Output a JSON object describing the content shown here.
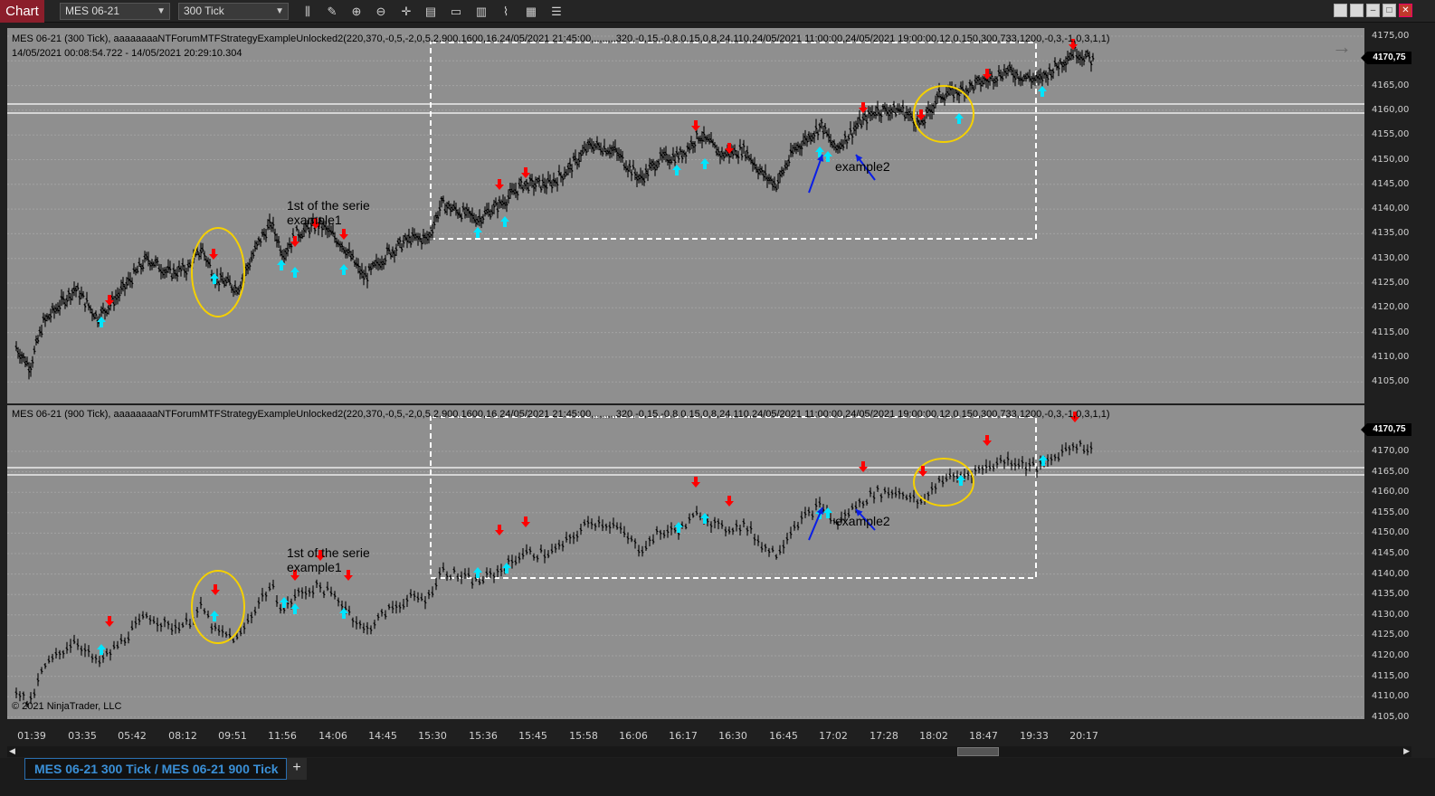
{
  "app": {
    "tab_label": "Chart"
  },
  "toolbar": {
    "instrument": "MES 06-21",
    "interval": "300 Tick",
    "icons": [
      "bar-type-icon",
      "draw-icon",
      "zoom-in-icon",
      "zoom-out-icon",
      "crosshair-icon",
      "data-box-icon",
      "drawing-objects-icon",
      "indicators-icon",
      "strategies-icon",
      "properties-icon",
      "menu-icon"
    ]
  },
  "panel_top": {
    "header": "MES 06-21 (300 Tick), aaaaaaaaNTForumMTFStrategyExampleUnlocked2(220,370,-0,5,-2,0,5,2,900,1600,16,24/05/2021 21:45:00,,,,,,,,,320,-0,15,-0,8,0,15,0,8,24,110,24/05/2021 11:00:00,24/05/2021 19:00:00,12,0,150,300,733,1200,-0,3,-1,0,3,1,1)",
    "date_range": "14/05/2021 00:08:54.722 - 14/05/2021 20:29:10.304",
    "annotation1_line1": "1st of the serie",
    "annotation1_line2": "example1",
    "annotation2": "example2",
    "last_price": "4170,75",
    "price_ticks": [
      "4175,00",
      "4170,00",
      "4165,00",
      "4160,00",
      "4155,00",
      "4150,00",
      "4145,00",
      "4140,00",
      "4135,00",
      "4130,00",
      "4125,00",
      "4120,00",
      "4115,00",
      "4110,00",
      "4105,00"
    ]
  },
  "panel_bottom": {
    "header": "MES 06-21 (900 Tick), aaaaaaaaNTForumMTFStrategyExampleUnlocked2(220,370,-0,5,-2,0,5,2,900,1600,16,24/05/2021 21:45:00,,,,,,,,,320,-0,15,-0,8,0,15,0,8,24,110,24/05/2021 11:00:00,24/05/2021 19:00:00,12,0,150,300,733,1200,-0,3,-1,0,3,1,1)",
    "annotation1_line1": "1st of the serie",
    "annotation1_line2": "example1",
    "annotation2": "example2",
    "last_price": "4170,75",
    "price_ticks": [
      "4170,00",
      "4165,00",
      "4160,00",
      "4155,00",
      "4150,00",
      "4145,00",
      "4140,00",
      "4135,00",
      "4130,00",
      "4125,00",
      "4120,00",
      "4115,00",
      "4110,00",
      "4105,00"
    ],
    "copyright": "© 2021 NinjaTrader, LLC"
  },
  "time_axis": [
    "01:39",
    "03:35",
    "05:42",
    "08:12",
    "09:51",
    "11:56",
    "14:06",
    "14:45",
    "15:30",
    "15:36",
    "15:45",
    "15:58",
    "16:06",
    "16:17",
    "16:30",
    "16:45",
    "17:02",
    "17:28",
    "18:02",
    "18:47",
    "19:33",
    "20:17"
  ],
  "bottom_tab": {
    "label": "MES 06-21 300 Tick / MES 06-21 900 Tick",
    "add": "+"
  },
  "colors": {
    "panel_bg": "#8f8f8f",
    "chart_tab": "#8b1e2b",
    "up_arrow": "#00e5ff",
    "down_arrow": "#ff0000",
    "circle": "#f5d000",
    "blue_arrow": "#0a1ee6"
  }
}
